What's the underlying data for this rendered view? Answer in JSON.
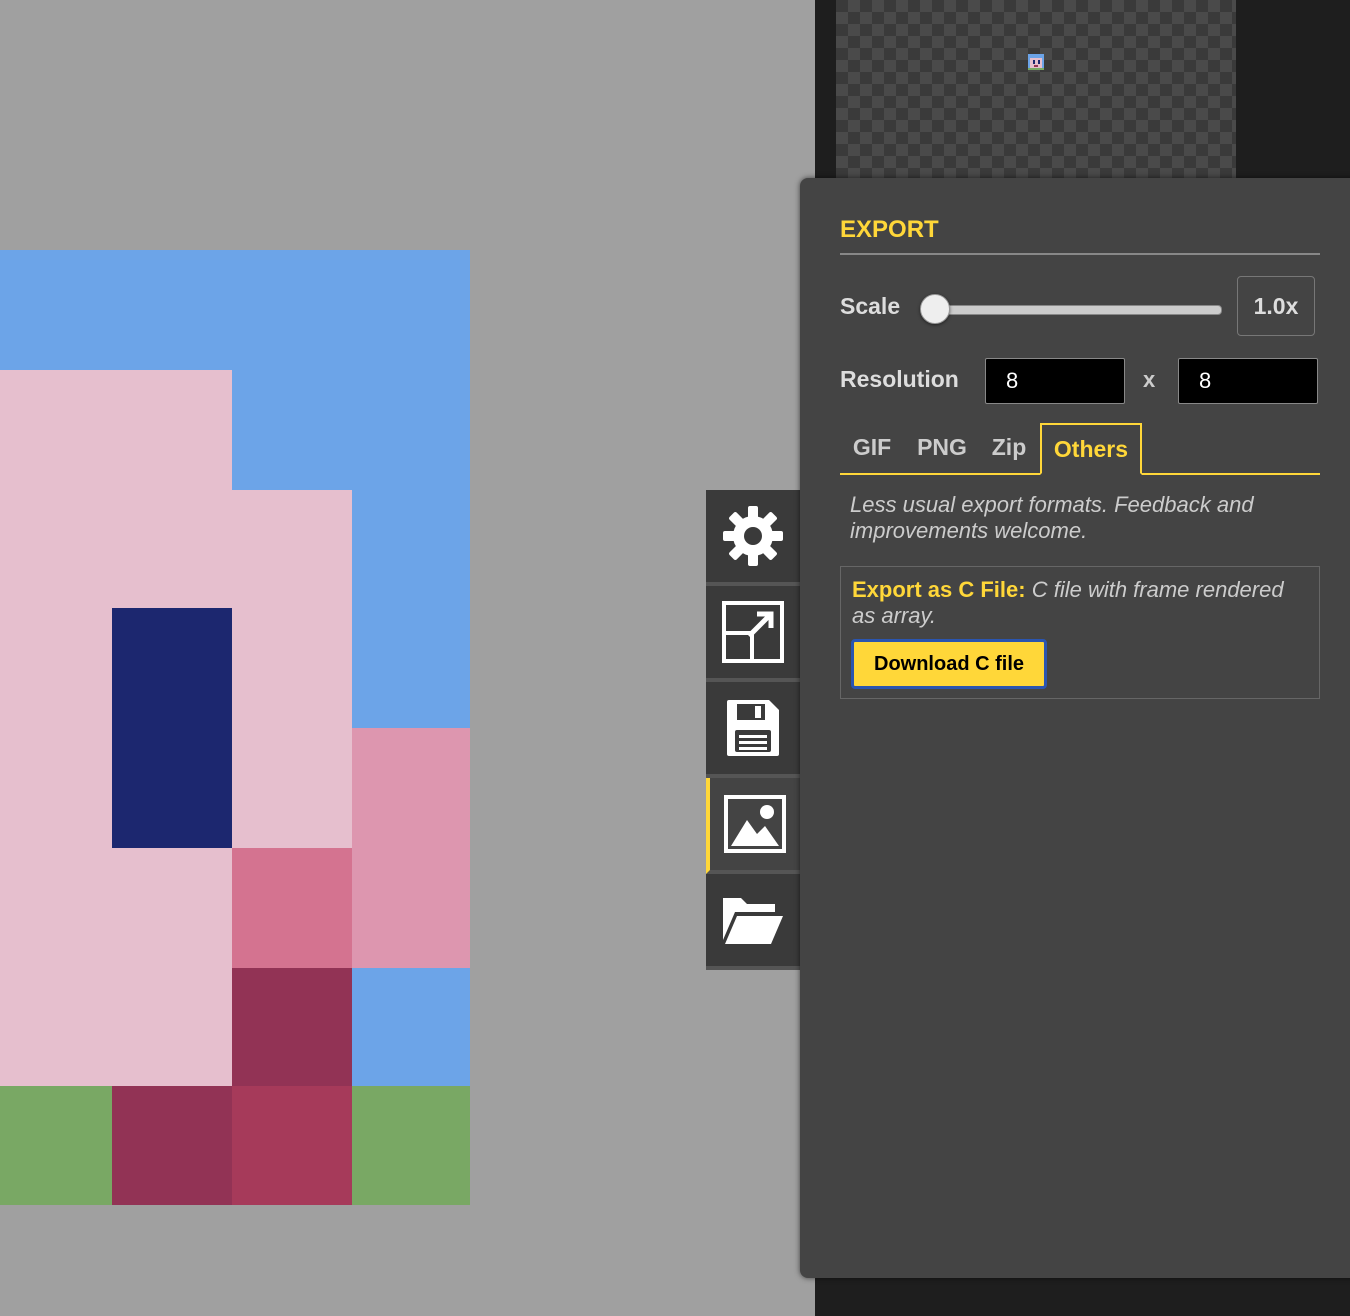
{
  "export_panel": {
    "title": "EXPORT",
    "scale_label": "Scale",
    "scale_value": "1.0x",
    "scale_slider_position": 0,
    "resolution_label": "Resolution",
    "resolution_width": "8",
    "resolution_separator": "x",
    "resolution_height": "8",
    "tabs": [
      {
        "label": "GIF",
        "active": false
      },
      {
        "label": "PNG",
        "active": false
      },
      {
        "label": "Zip",
        "active": false
      },
      {
        "label": "Others",
        "active": true
      }
    ],
    "description": "Less usual export formats. Feedback and improvements welcome.",
    "c_export": {
      "title": "Export as C File:",
      "text": " C file with frame rendered as array.",
      "button_label": "Download C file"
    }
  },
  "side_tabs": [
    {
      "icon": "gear-icon",
      "active": false
    },
    {
      "icon": "resize-icon",
      "active": false
    },
    {
      "icon": "save-icon",
      "active": false
    },
    {
      "icon": "image-icon",
      "active": true
    },
    {
      "icon": "folder-open-icon",
      "active": false
    }
  ],
  "colors": {
    "accent": "#ffd739",
    "panel_bg": "#444444",
    "sky_blue": "#6ca4e8",
    "light_pink": "#e6bfce",
    "mid_pink": "#dd96af",
    "deep_pink": "#d47390",
    "navy": "#1c276f",
    "maroon": "#923355",
    "crimson": "#a63a5a",
    "green": "#79a864"
  }
}
